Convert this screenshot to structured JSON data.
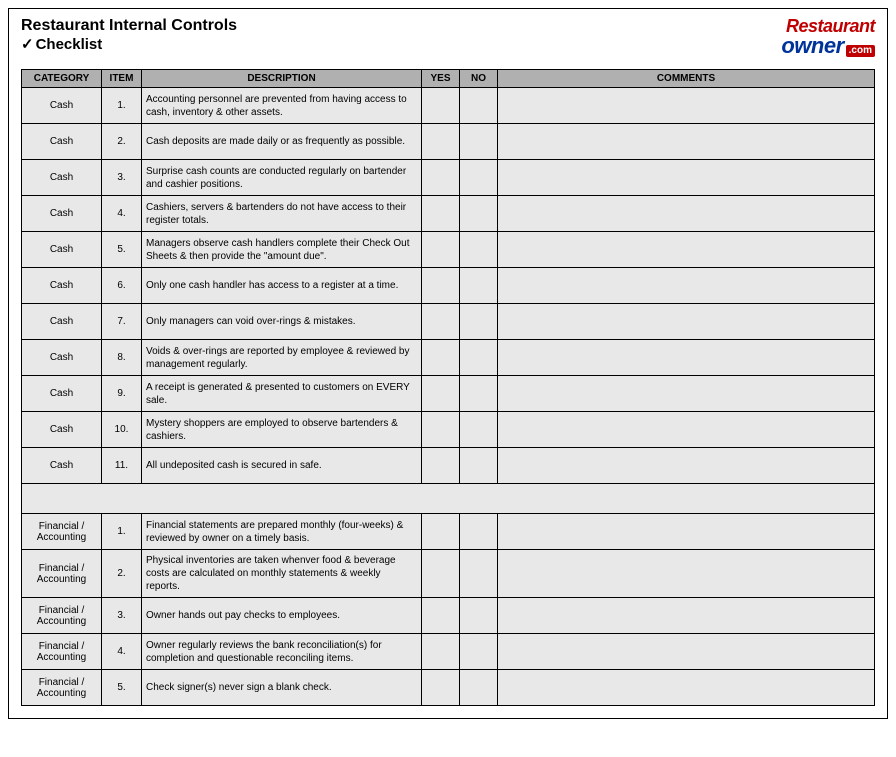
{
  "header": {
    "title_line1": "Restaurant Internal Controls",
    "title_line2": "Checklist",
    "logo_line1": "Restaurant",
    "logo_owner": "owner",
    "logo_dotcom": ".com"
  },
  "columns": {
    "category": "CATEGORY",
    "item": "ITEM",
    "description": "DESCRIPTION",
    "yes": "YES",
    "no": "NO",
    "comments": "COMMENTS"
  },
  "rows": [
    {
      "category": "Cash",
      "item": "1.",
      "description": "Accounting personnel are prevented from having access to cash, inventory & other assets."
    },
    {
      "category": "Cash",
      "item": "2.",
      "description": "Cash deposits are made daily or as frequently as possible."
    },
    {
      "category": "Cash",
      "item": "3.",
      "description": "Surprise cash counts are conducted regularly on bartender and cashier positions."
    },
    {
      "category": "Cash",
      "item": "4.",
      "description": "Cashiers, servers & bartenders do not have access to their register totals."
    },
    {
      "category": "Cash",
      "item": "5.",
      "description": "Managers observe cash handlers complete their Check Out Sheets & then provide the \"amount due\"."
    },
    {
      "category": "Cash",
      "item": "6.",
      "description": "Only one cash handler has access to a register at a time."
    },
    {
      "category": "Cash",
      "item": "7.",
      "description": "Only managers can void over-rings & mistakes."
    },
    {
      "category": "Cash",
      "item": "8.",
      "description": "Voids & over-rings are reported by employee & reviewed by management regularly."
    },
    {
      "category": "Cash",
      "item": "9.",
      "description": "A receipt is generated & presented to customers on EVERY sale."
    },
    {
      "category": "Cash",
      "item": "10.",
      "description": "Mystery shoppers are employed to observe bartenders & cashiers."
    },
    {
      "category": "Cash",
      "item": "11.",
      "description": "All undeposited cash is secured in safe."
    },
    {
      "spacer": true
    },
    {
      "category": "Financial / Accounting",
      "item": "1.",
      "description": "Financial statements are prepared monthly (four-weeks) & reviewed by owner on a timely basis."
    },
    {
      "category": "Financial / Accounting",
      "item": "2.",
      "description": "Physical inventories are taken whenver food & beverage costs are calculated on monthly statements & weekly reports."
    },
    {
      "category": "Financial / Accounting",
      "item": "3.",
      "description": "Owner hands out pay checks to employees."
    },
    {
      "category": "Financial / Accounting",
      "item": "4.",
      "description": "Owner regularly reviews the bank reconciliation(s) for completion and questionable reconciling items."
    },
    {
      "category": "Financial / Accounting",
      "item": "5.",
      "description": "Check signer(s) never sign a blank check."
    }
  ]
}
